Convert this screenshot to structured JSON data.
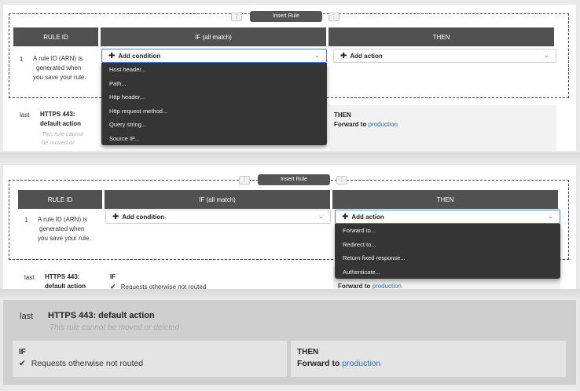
{
  "insert_rule_label": "Insert Rule",
  "insert_handle_glyph": "⋮",
  "headers": {
    "rule_id": "RULE ID",
    "if": "IF (all match)",
    "then": "THEN"
  },
  "rule1": {
    "number": "1",
    "arn_line1": "A rule ID (ARN) is",
    "arn_line2": "generated when",
    "arn_line3": "you save your rule."
  },
  "add_condition_label": "Add condition",
  "add_action_label": "Add action",
  "plus_glyph": "✚",
  "chevron_glyph": "⌄",
  "condition_options": [
    "Host header...",
    "Path...",
    "Http header...",
    "Http request method...",
    "Query string...",
    "Source IP..."
  ],
  "action_options": [
    "Forward to...",
    "Redirect to...",
    "Return fixed response...",
    "Authenticate..."
  ],
  "default_rule": {
    "position": "last",
    "title_line1": "HTTPS 443:",
    "title_line2": "default action",
    "title_full": "HTTPS 443: default action",
    "note_line1": "This rule cannot",
    "note_line2": "be moved or",
    "note_full": "This rule cannot be moved or deleted",
    "if_label": "IF",
    "if_condition": "Requests otherwise not routed",
    "then_label": "THEN",
    "forward_to": "Forward to",
    "target_group": "production",
    "check_glyph": "✔"
  },
  "colors": {
    "header_bg": "#515151",
    "dropdown_bg": "#353535",
    "link": "#2a6ebb",
    "focus_border": "#4a7bd4"
  }
}
